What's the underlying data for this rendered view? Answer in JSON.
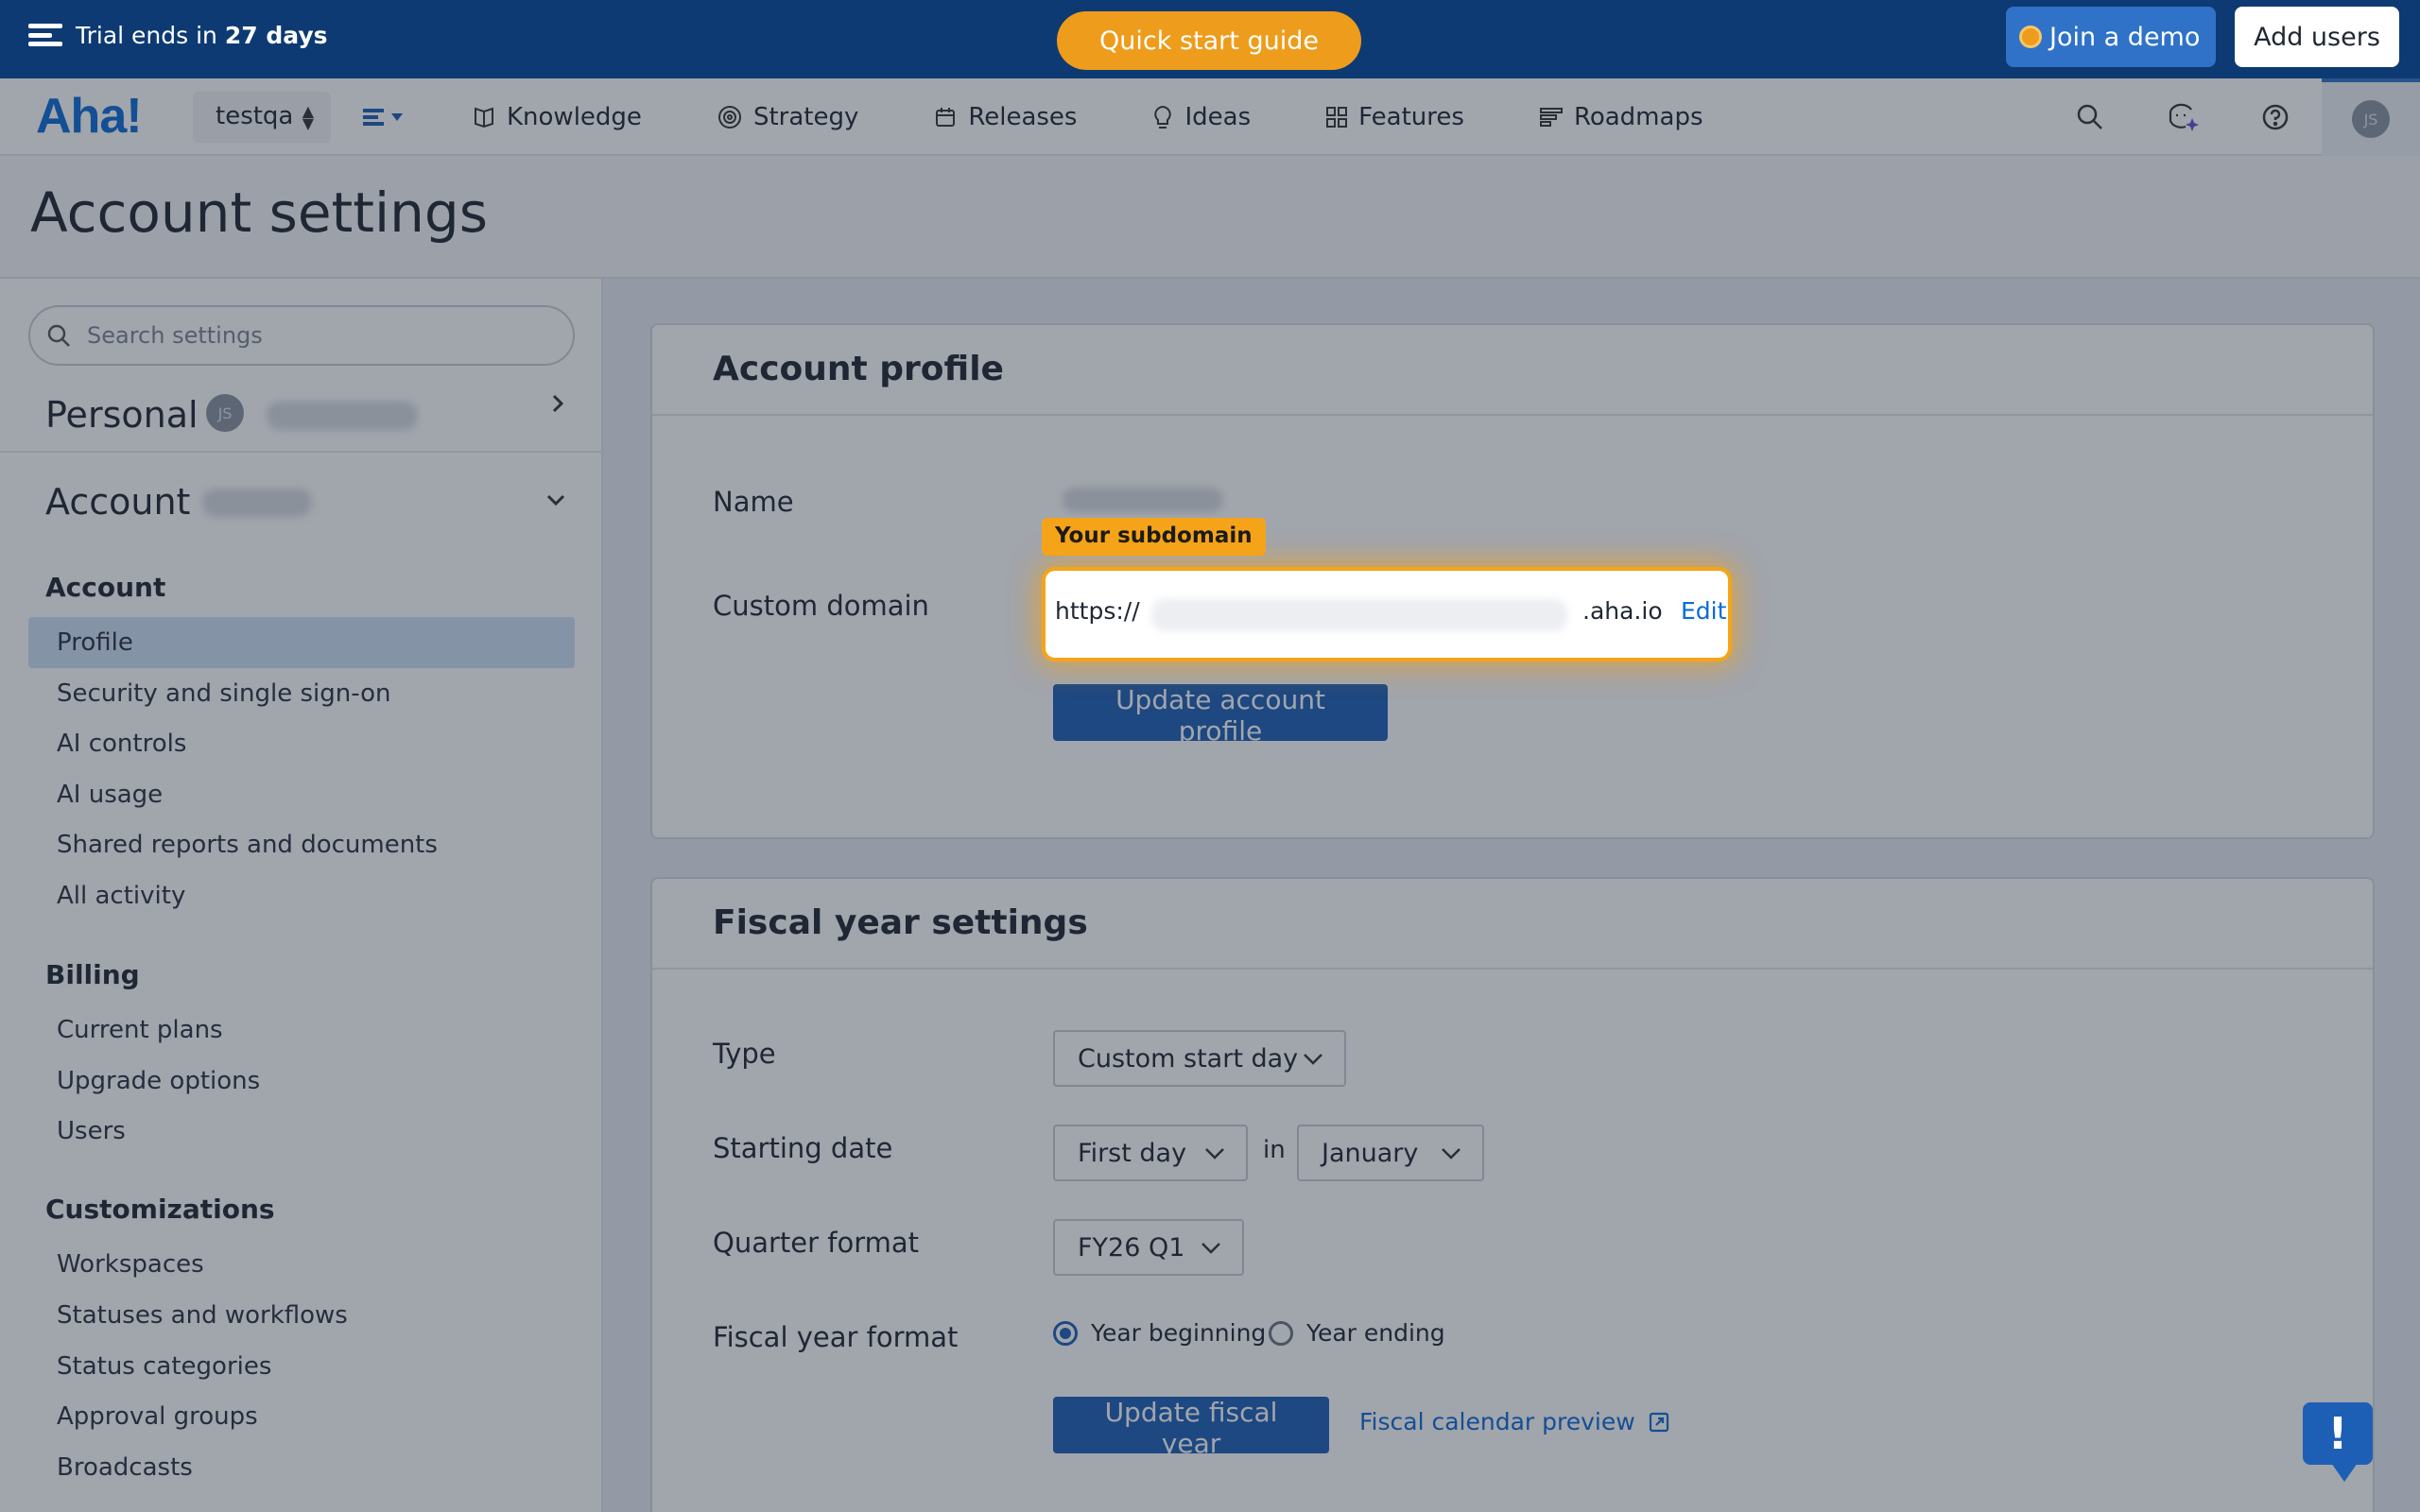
{
  "trial": {
    "prefix": "Trial ends in",
    "days": "27 days"
  },
  "quick_start_label": "Quick start guide",
  "join_demo_label": "Join a demo",
  "add_users_label": "Add users",
  "nav": {
    "logo": "Aha!",
    "workspace": "testqa",
    "links": [
      "Knowledge",
      "Strategy",
      "Releases",
      "Ideas",
      "Features",
      "Roadmaps"
    ],
    "avatar_initials": "JS"
  },
  "page_title": "Account settings",
  "sidebar": {
    "search_placeholder": "Search settings",
    "personal_label": "Personal",
    "personal_initials": "JS",
    "account_label": "Account",
    "groups": [
      {
        "title": "Account",
        "items": [
          "Profile",
          "Security and single sign-on",
          "AI controls",
          "AI usage",
          "Shared reports and documents",
          "All activity"
        ]
      },
      {
        "title": "Billing",
        "items": [
          "Current plans",
          "Upgrade options",
          "Users"
        ]
      },
      {
        "title": "Customizations",
        "items": [
          "Workspaces",
          "Statuses and workflows",
          "Status categories",
          "Approval groups",
          "Broadcasts"
        ]
      }
    ]
  },
  "account_profile": {
    "heading": "Account profile",
    "name_label": "Name",
    "custom_domain_label": "Custom domain",
    "subdomain_tag": "Your subdomain",
    "domain_prefix": "https://",
    "domain_suffix": ".aha.io",
    "edit_label": "Edit",
    "update_label": "Update account profile"
  },
  "fiscal_year": {
    "heading": "Fiscal year settings",
    "type_label": "Type",
    "type_value": "Custom start day",
    "starting_date_label": "Starting date",
    "start_day_value": "First day",
    "in_text": "in",
    "start_month_value": "January",
    "quarter_format_label": "Quarter format",
    "quarter_format_value": "FY26 Q1",
    "fiscal_year_format_label": "Fiscal year format",
    "format_options": [
      "Year beginning",
      "Year ending"
    ],
    "selected_format": "Year beginning",
    "update_label": "Update fiscal year",
    "preview_link": "Fiscal calendar preview"
  },
  "colors": {
    "brand": "#0d3a73",
    "accent": "#ee9c1b",
    "primary": "#1d5fb5",
    "highlight": "#f5a41a"
  }
}
